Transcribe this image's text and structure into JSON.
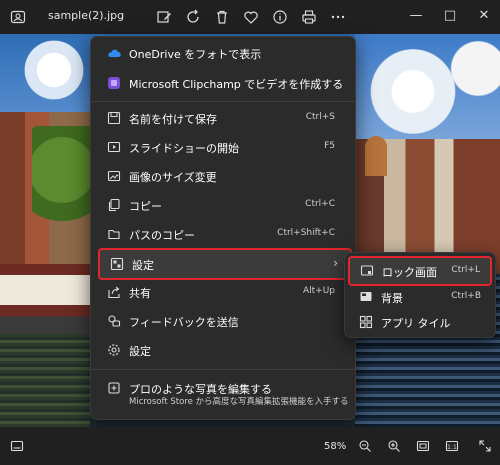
{
  "titlebar": {
    "filename": "sample(2).jpg",
    "toolbar_icons": [
      "edit-image-icon",
      "rotate-icon",
      "delete-icon",
      "favorite-icon",
      "info-icon",
      "print-icon",
      "more-icon"
    ],
    "window_buttons": {
      "minimize": "—",
      "maximize": "□",
      "close": "✕"
    }
  },
  "menu": {
    "items": [
      {
        "label": "OneDrive をフォトで表示",
        "shortcut": ""
      },
      {
        "label": "Microsoft Clipchamp でビデオを作成する",
        "shortcut": ""
      },
      {
        "label": "名前を付けて保存",
        "shortcut": "Ctrl+S"
      },
      {
        "label": "スライドショーの開始",
        "shortcut": "F5"
      },
      {
        "label": "画像のサイズ変更",
        "shortcut": ""
      },
      {
        "label": "コピー",
        "shortcut": "Ctrl+C"
      },
      {
        "label": "パスのコピー",
        "shortcut": "Ctrl+Shift+C"
      },
      {
        "label": "設定",
        "shortcut": ""
      },
      {
        "label": "共有",
        "shortcut": "Alt+Up"
      },
      {
        "label": "フィードバックを送信",
        "shortcut": ""
      },
      {
        "label": "設定",
        "shortcut": ""
      },
      {
        "label": "プロのような写真を編集する",
        "sublabel": "Microsoft Store から高度な写真編集拡張機能を入手する"
      }
    ],
    "chevron": "›"
  },
  "submenu": {
    "items": [
      {
        "label": "ロック画面",
        "shortcut": "Ctrl+L"
      },
      {
        "label": "背景",
        "shortcut": "Ctrl+B"
      },
      {
        "label": "アプリ タイル",
        "shortcut": ""
      }
    ]
  },
  "statusbar": {
    "zoom": "58%"
  },
  "colors": {
    "accent_red": "#e0262c",
    "menu_bg": "#2b2b2b"
  }
}
